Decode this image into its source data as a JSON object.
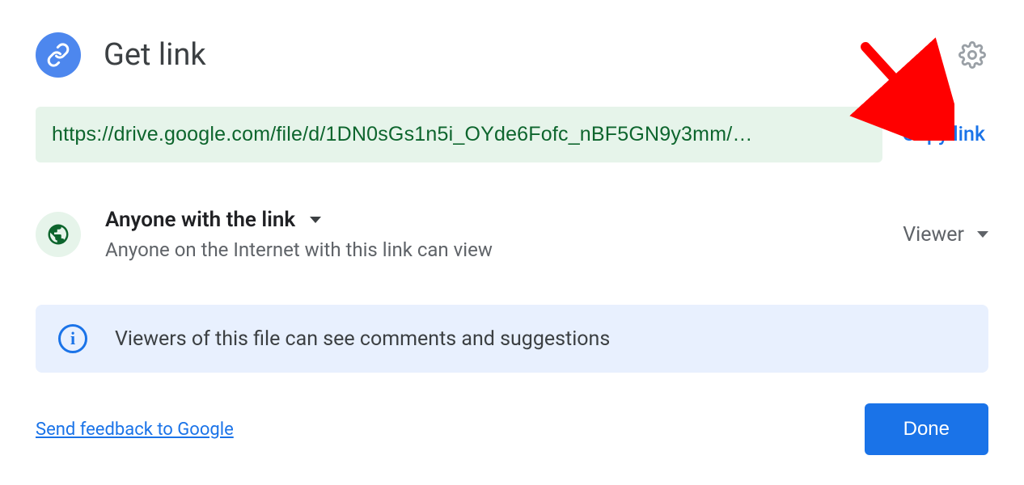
{
  "header": {
    "title": "Get link"
  },
  "link": {
    "url": "https://drive.google.com/file/d/1DN0sGs1n5i_OYde6Fofc_nBF5GN9y3mm/…",
    "copy_label": "Copy link"
  },
  "scope": {
    "title": "Anyone with the link",
    "description": "Anyone on the Internet with this link can view",
    "role": "Viewer"
  },
  "info_banner": {
    "text": "Viewers of this file can see comments and suggestions"
  },
  "footer": {
    "feedback_label": "Send feedback to Google",
    "done_label": "Done"
  }
}
